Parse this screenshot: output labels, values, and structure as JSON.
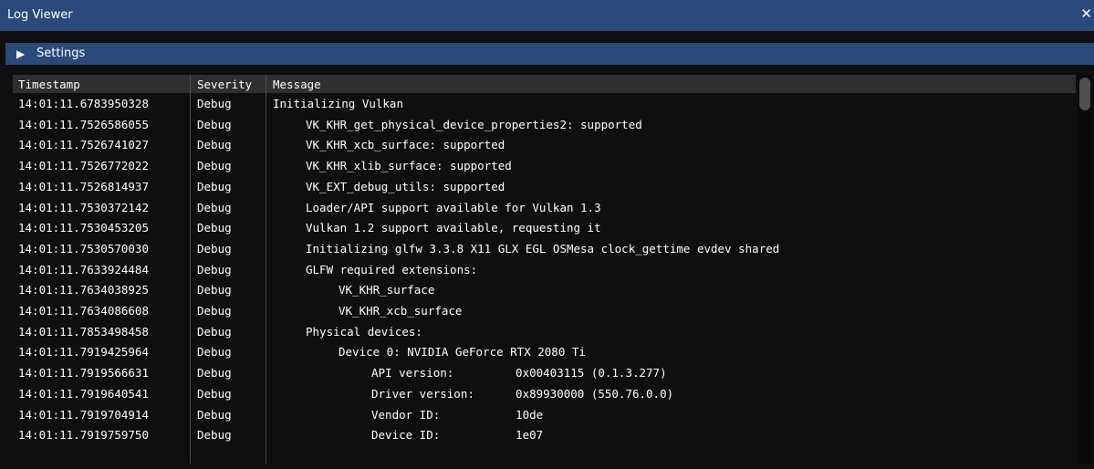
{
  "window": {
    "title": "Log Viewer",
    "close_glyph": "✕"
  },
  "settings": {
    "arrow_glyph": "▶",
    "label": "Settings"
  },
  "table": {
    "columns": [
      "Timestamp",
      "Severity",
      "Message"
    ],
    "rows": [
      {
        "ts": "14:01:11.6783950328",
        "sev": "Debug",
        "msg": "Initializing Vulkan",
        "indent": 0
      },
      {
        "ts": "14:01:11.7526586055",
        "sev": "Debug",
        "msg": "VK_KHR_get_physical_device_properties2: supported",
        "indent": 1
      },
      {
        "ts": "14:01:11.7526741027",
        "sev": "Debug",
        "msg": "VK_KHR_xcb_surface: supported",
        "indent": 1
      },
      {
        "ts": "14:01:11.7526772022",
        "sev": "Debug",
        "msg": "VK_KHR_xlib_surface: supported",
        "indent": 1
      },
      {
        "ts": "14:01:11.7526814937",
        "sev": "Debug",
        "msg": "VK_EXT_debug_utils: supported",
        "indent": 1
      },
      {
        "ts": "14:01:11.7530372142",
        "sev": "Debug",
        "msg": "Loader/API support available for Vulkan 1.3",
        "indent": 1
      },
      {
        "ts": "14:01:11.7530453205",
        "sev": "Debug",
        "msg": "Vulkan 1.2 support available, requesting it",
        "indent": 1
      },
      {
        "ts": "14:01:11.7530570030",
        "sev": "Debug",
        "msg": "Initializing glfw 3.3.8 X11 GLX EGL OSMesa clock_gettime evdev shared",
        "indent": 1
      },
      {
        "ts": "14:01:11.7633924484",
        "sev": "Debug",
        "msg": "GLFW required extensions:",
        "indent": 1
      },
      {
        "ts": "14:01:11.7634038925",
        "sev": "Debug",
        "msg": "VK_KHR_surface",
        "indent": 2
      },
      {
        "ts": "14:01:11.7634086608",
        "sev": "Debug",
        "msg": "VK_KHR_xcb_surface",
        "indent": 2
      },
      {
        "ts": "14:01:11.7853498458",
        "sev": "Debug",
        "msg": "Physical devices:",
        "indent": 1
      },
      {
        "ts": "14:01:11.7919425964",
        "sev": "Debug",
        "msg": "Device 0: NVIDIA GeForce RTX 2080 Ti",
        "indent": 2
      },
      {
        "ts": "14:01:11.7919566631",
        "sev": "Debug",
        "msg": "API version:         0x00403115 (0.1.3.277)",
        "indent": 3
      },
      {
        "ts": "14:01:11.7919640541",
        "sev": "Debug",
        "msg": "Driver version:      0x89930000 (550.76.0.0)",
        "indent": 3
      },
      {
        "ts": "14:01:11.7919704914",
        "sev": "Debug",
        "msg": "Vendor ID:           10de",
        "indent": 3
      },
      {
        "ts": "14:01:11.7919759750",
        "sev": "Debug",
        "msg": "Device ID:           1e07",
        "indent": 3
      }
    ]
  },
  "colors": {
    "title_bar": "#294a7a",
    "header_bar": "#294a7a",
    "column_header": "#2f2f32",
    "background": "#0f0f0f",
    "text": "#ffffff"
  }
}
